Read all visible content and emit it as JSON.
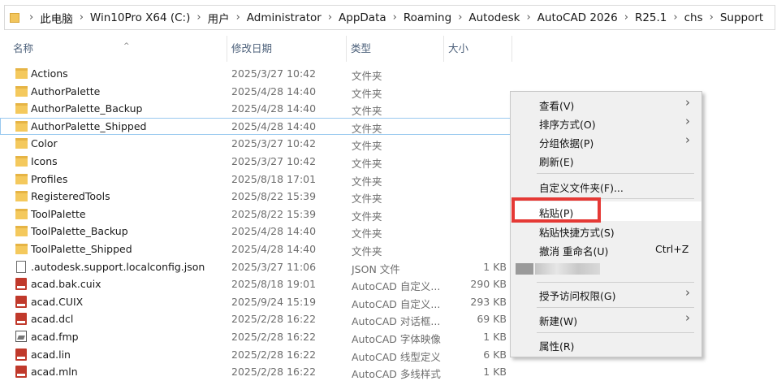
{
  "address_bar": {
    "crumbs": [
      "此电脑",
      "Win10Pro X64 (C:)",
      "用户",
      "Administrator",
      "AppData",
      "Roaming",
      "Autodesk",
      "AutoCAD 2026",
      "R25.1",
      "chs",
      "Support"
    ]
  },
  "columns": {
    "name": "名称",
    "date": "修改日期",
    "type": "类型",
    "size": "大小"
  },
  "files": [
    {
      "name": "Actions",
      "date": "2025/3/27 10:42",
      "type": "文件夹",
      "size": "",
      "icon": "folder-icon"
    },
    {
      "name": "AuthorPalette",
      "date": "2025/4/28 14:40",
      "type": "文件夹",
      "size": "",
      "icon": "folder-icon"
    },
    {
      "name": "AuthorPalette_Backup",
      "date": "2025/4/28 14:40",
      "type": "文件夹",
      "size": "",
      "icon": "folder-icon"
    },
    {
      "name": "AuthorPalette_Shipped",
      "date": "2025/4/28 14:40",
      "type": "文件夹",
      "size": "",
      "icon": "folder-icon"
    },
    {
      "name": "Color",
      "date": "2025/3/27 10:42",
      "type": "文件夹",
      "size": "",
      "icon": "folder-icon"
    },
    {
      "name": "Icons",
      "date": "2025/3/27 10:42",
      "type": "文件夹",
      "size": "",
      "icon": "folder-icon"
    },
    {
      "name": "Profiles",
      "date": "2025/8/18 17:01",
      "type": "文件夹",
      "size": "",
      "icon": "folder-icon"
    },
    {
      "name": "RegisteredTools",
      "date": "2025/8/22 15:39",
      "type": "文件夹",
      "size": "",
      "icon": "folder-icon"
    },
    {
      "name": "ToolPalette",
      "date": "2025/8/22 15:39",
      "type": "文件夹",
      "size": "",
      "icon": "folder-icon"
    },
    {
      "name": "ToolPalette_Backup",
      "date": "2025/4/28 14:40",
      "type": "文件夹",
      "size": "",
      "icon": "folder-icon"
    },
    {
      "name": "ToolPalette_Shipped",
      "date": "2025/4/28 14:40",
      "type": "文件夹",
      "size": "",
      "icon": "folder-icon"
    },
    {
      "name": ".autodesk.support.localconfig.json",
      "date": "2025/3/27 11:06",
      "type": "JSON 文件",
      "size": "1 KB",
      "icon": "document-icon"
    },
    {
      "name": "acad.bak.cuix",
      "date": "2025/8/18 19:01",
      "type": "AutoCAD 自定义...",
      "size": "290 KB",
      "icon": "autocad-file-icon"
    },
    {
      "name": "acad.CUIX",
      "date": "2025/9/24 15:19",
      "type": "AutoCAD 自定义...",
      "size": "293 KB",
      "icon": "autocad-file-icon"
    },
    {
      "name": "acad.dcl",
      "date": "2025/2/28 16:22",
      "type": "AutoCAD 对话框...",
      "size": "69 KB",
      "icon": "autocad-file-icon"
    },
    {
      "name": "acad.fmp",
      "date": "2025/2/28 16:22",
      "type": "AutoCAD 字体映像",
      "size": "1 KB",
      "icon": "image-file-icon"
    },
    {
      "name": "acad.lin",
      "date": "2025/2/28 16:22",
      "type": "AutoCAD 线型定义",
      "size": "6 KB",
      "icon": "autocad-file-icon"
    },
    {
      "name": "acad.mln",
      "date": "2025/2/28 16:22",
      "type": "AutoCAD 多线样式",
      "size": "1 KB",
      "icon": "autocad-file-icon"
    }
  ],
  "context_menu": {
    "view": "查看(V)",
    "sort_by": "排序方式(O)",
    "group_by": "分组依据(P)",
    "refresh": "刷新(E)",
    "customize_folder": "自定义文件夹(F)...",
    "paste": "粘贴(P)",
    "paste_shortcut": "粘贴快捷方式(S)",
    "undo_rename": "撤消 重命名(U)",
    "undo_shortcut": "Ctrl+Z",
    "give_access": "授予访问权限(G)",
    "new": "新建(W)",
    "properties": "属性(R)"
  },
  "colors": {
    "highlight_box": "#e53935",
    "header_text": "#4c607a"
  }
}
